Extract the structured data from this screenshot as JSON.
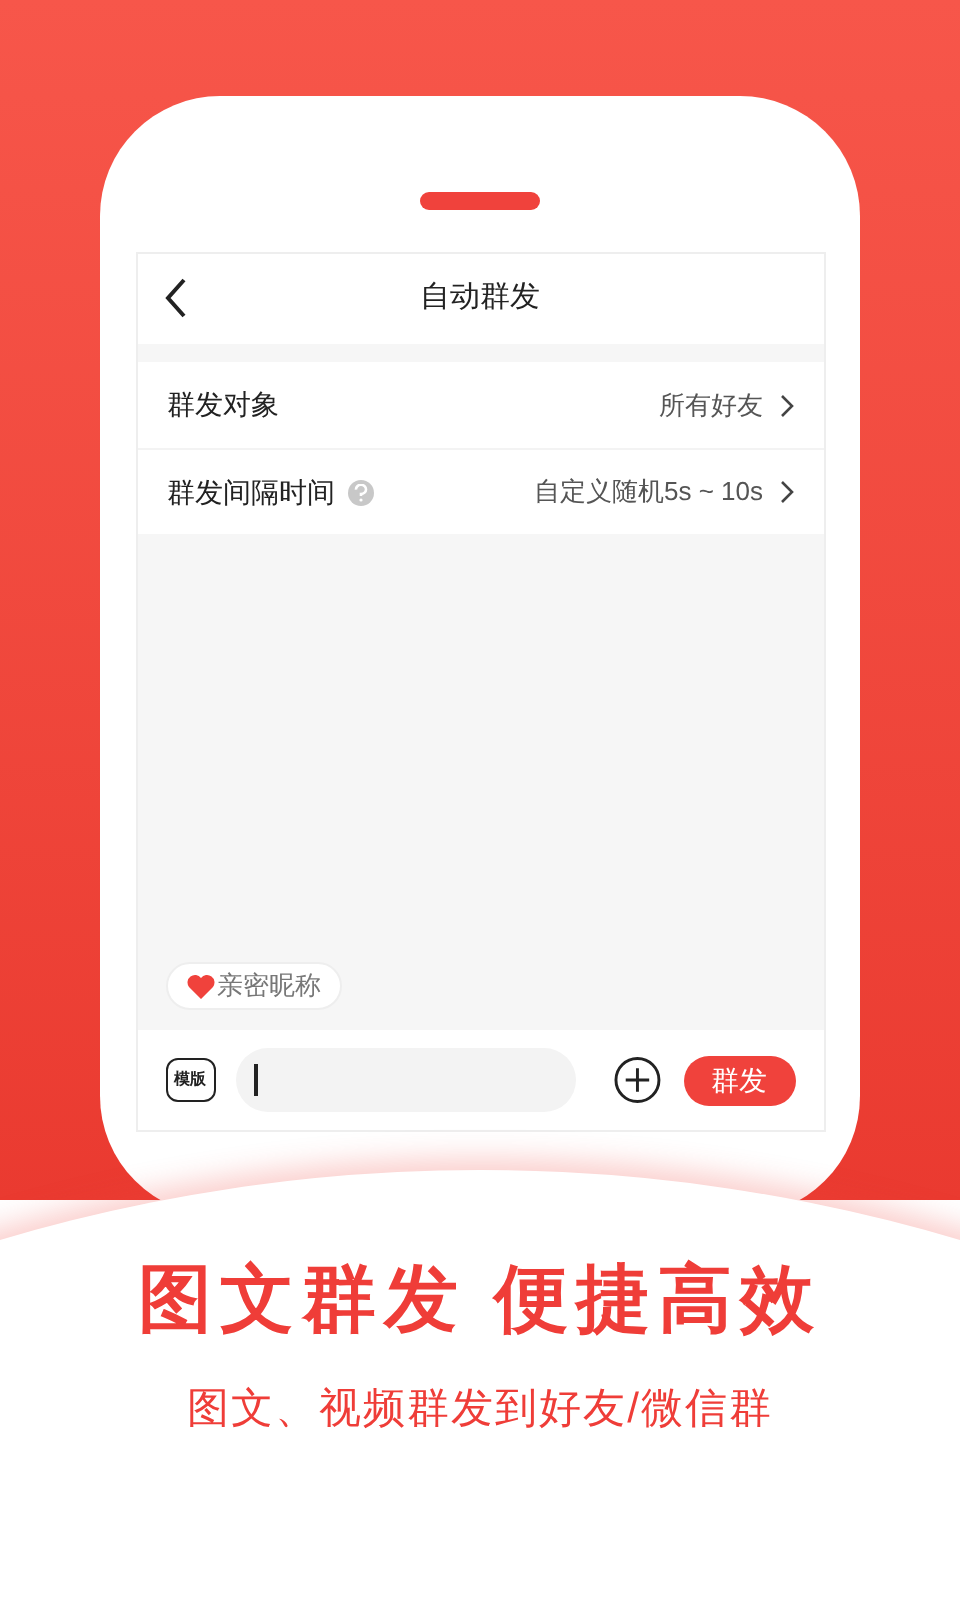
{
  "header": {
    "title": "自动群发"
  },
  "settings": [
    {
      "label": "群发对象",
      "help": false,
      "value": "所有好友"
    },
    {
      "label": "群发间隔时间",
      "help": true,
      "value": "自定义随机5s ~ 10s"
    }
  ],
  "chip": {
    "label": "亲密昵称"
  },
  "composer": {
    "template_label": "模版",
    "send_button": "群发"
  },
  "headline": "图文群发 便捷高效",
  "subtitle": "图文、视频群发到好友/微信群"
}
